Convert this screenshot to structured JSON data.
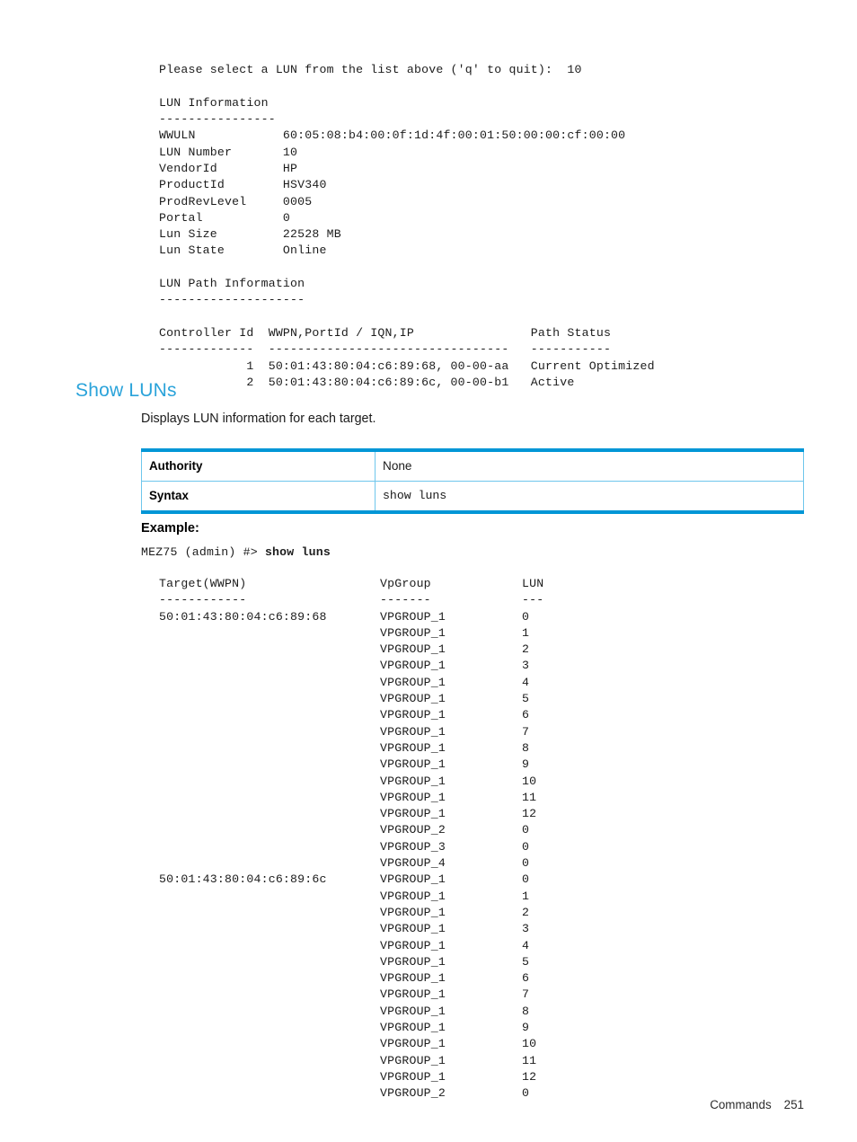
{
  "terminal_top": {
    "lines": [
      "Please select a LUN from the list above ('q' to quit):  10",
      "",
      "LUN Information",
      "----------------",
      "WWULN            60:05:08:b4:00:0f:1d:4f:00:01:50:00:00:cf:00:00",
      "LUN Number       10",
      "VendorId         HP",
      "ProductId        HSV340",
      "ProdRevLevel     0005",
      "Portal           0",
      "Lun Size         22528 MB",
      "Lun State        Online",
      "",
      "LUN Path Information",
      "--------------------",
      "",
      "Controller Id  WWPN,PortId / IQN,IP                Path Status",
      "-------------  ---------------------------------   -----------",
      "            1  50:01:43:80:04:c6:89:68, 00-00-aa   Current Optimized",
      "            2  50:01:43:80:04:c6:89:6c, 00-00-b1   Active"
    ],
    "lun_information": {
      "header": "LUN Information",
      "fields": [
        {
          "name": "WWULN",
          "value": "60:05:08:b4:00:0f:1d:4f:00:01:50:00:00:cf:00:00"
        },
        {
          "name": "LUN Number",
          "value": "10"
        },
        {
          "name": "VendorId",
          "value": "HP"
        },
        {
          "name": "ProductId",
          "value": "HSV340"
        },
        {
          "name": "ProdRevLevel",
          "value": "0005"
        },
        {
          "name": "Portal",
          "value": "0"
        },
        {
          "name": "Lun Size",
          "value": "22528 MB"
        },
        {
          "name": "Lun State",
          "value": "Online"
        }
      ]
    },
    "lun_path_information": {
      "header": "LUN Path Information",
      "columns": [
        "Controller Id",
        "WWPN,PortId / IQN,IP",
        "Path Status"
      ],
      "rows": [
        {
          "controller_id": "1",
          "wwpn_portid": "50:01:43:80:04:c6:89:68, 00-00-aa",
          "path_status": "Current Optimized"
        },
        {
          "controller_id": "2",
          "wwpn_portid": "50:01:43:80:04:c6:89:6c, 00-00-b1",
          "path_status": "Active"
        }
      ]
    }
  },
  "section": {
    "heading": "Show LUNs",
    "description": "Displays LUN information for each target."
  },
  "spec_table": {
    "rows": [
      {
        "key": "Authority",
        "value": "None",
        "mono": false
      },
      {
        "key": "Syntax",
        "value": "show luns",
        "mono": true
      }
    ]
  },
  "example": {
    "label": "Example:",
    "prompt_prefix": "MEZ75 (admin) #> ",
    "prompt_command": "show luns",
    "columns": {
      "target": "Target(WWPN)",
      "vpgroup": "VpGroup",
      "lun": "LUN"
    },
    "column_rules": {
      "target": "------------",
      "vpgroup": "-------",
      "lun": "---"
    },
    "rows": [
      {
        "target": "50:01:43:80:04:c6:89:68",
        "vpgroup": "VPGROUP_1",
        "lun": "0"
      },
      {
        "target": "",
        "vpgroup": "VPGROUP_1",
        "lun": "1"
      },
      {
        "target": "",
        "vpgroup": "VPGROUP_1",
        "lun": "2"
      },
      {
        "target": "",
        "vpgroup": "VPGROUP_1",
        "lun": "3"
      },
      {
        "target": "",
        "vpgroup": "VPGROUP_1",
        "lun": "4"
      },
      {
        "target": "",
        "vpgroup": "VPGROUP_1",
        "lun": "5"
      },
      {
        "target": "",
        "vpgroup": "VPGROUP_1",
        "lun": "6"
      },
      {
        "target": "",
        "vpgroup": "VPGROUP_1",
        "lun": "7"
      },
      {
        "target": "",
        "vpgroup": "VPGROUP_1",
        "lun": "8"
      },
      {
        "target": "",
        "vpgroup": "VPGROUP_1",
        "lun": "9"
      },
      {
        "target": "",
        "vpgroup": "VPGROUP_1",
        "lun": "10"
      },
      {
        "target": "",
        "vpgroup": "VPGROUP_1",
        "lun": "11"
      },
      {
        "target": "",
        "vpgroup": "VPGROUP_1",
        "lun": "12"
      },
      {
        "target": "",
        "vpgroup": "VPGROUP_2",
        "lun": "0"
      },
      {
        "target": "",
        "vpgroup": "VPGROUP_3",
        "lun": "0"
      },
      {
        "target": "",
        "vpgroup": "VPGROUP_4",
        "lun": "0"
      },
      {
        "target": "50:01:43:80:04:c6:89:6c",
        "vpgroup": "VPGROUP_1",
        "lun": "0"
      },
      {
        "target": "",
        "vpgroup": "VPGROUP_1",
        "lun": "1"
      },
      {
        "target": "",
        "vpgroup": "VPGROUP_1",
        "lun": "2"
      },
      {
        "target": "",
        "vpgroup": "VPGROUP_1",
        "lun": "3"
      },
      {
        "target": "",
        "vpgroup": "VPGROUP_1",
        "lun": "4"
      },
      {
        "target": "",
        "vpgroup": "VPGROUP_1",
        "lun": "5"
      },
      {
        "target": "",
        "vpgroup": "VPGROUP_1",
        "lun": "6"
      },
      {
        "target": "",
        "vpgroup": "VPGROUP_1",
        "lun": "7"
      },
      {
        "target": "",
        "vpgroup": "VPGROUP_1",
        "lun": "8"
      },
      {
        "target": "",
        "vpgroup": "VPGROUP_1",
        "lun": "9"
      },
      {
        "target": "",
        "vpgroup": "VPGROUP_1",
        "lun": "10"
      },
      {
        "target": "",
        "vpgroup": "VPGROUP_1",
        "lun": "11"
      },
      {
        "target": "",
        "vpgroup": "VPGROUP_1",
        "lun": "12"
      },
      {
        "target": "",
        "vpgroup": "VPGROUP_2",
        "lun": "0"
      }
    ]
  },
  "footer": {
    "chapter": "Commands",
    "page_number": "251"
  },
  "colors": {
    "heading": "#2aa3da",
    "table_border_strong": "#0096d6",
    "table_border_light": "#6ec6ec",
    "text": "#1a1a1a"
  }
}
